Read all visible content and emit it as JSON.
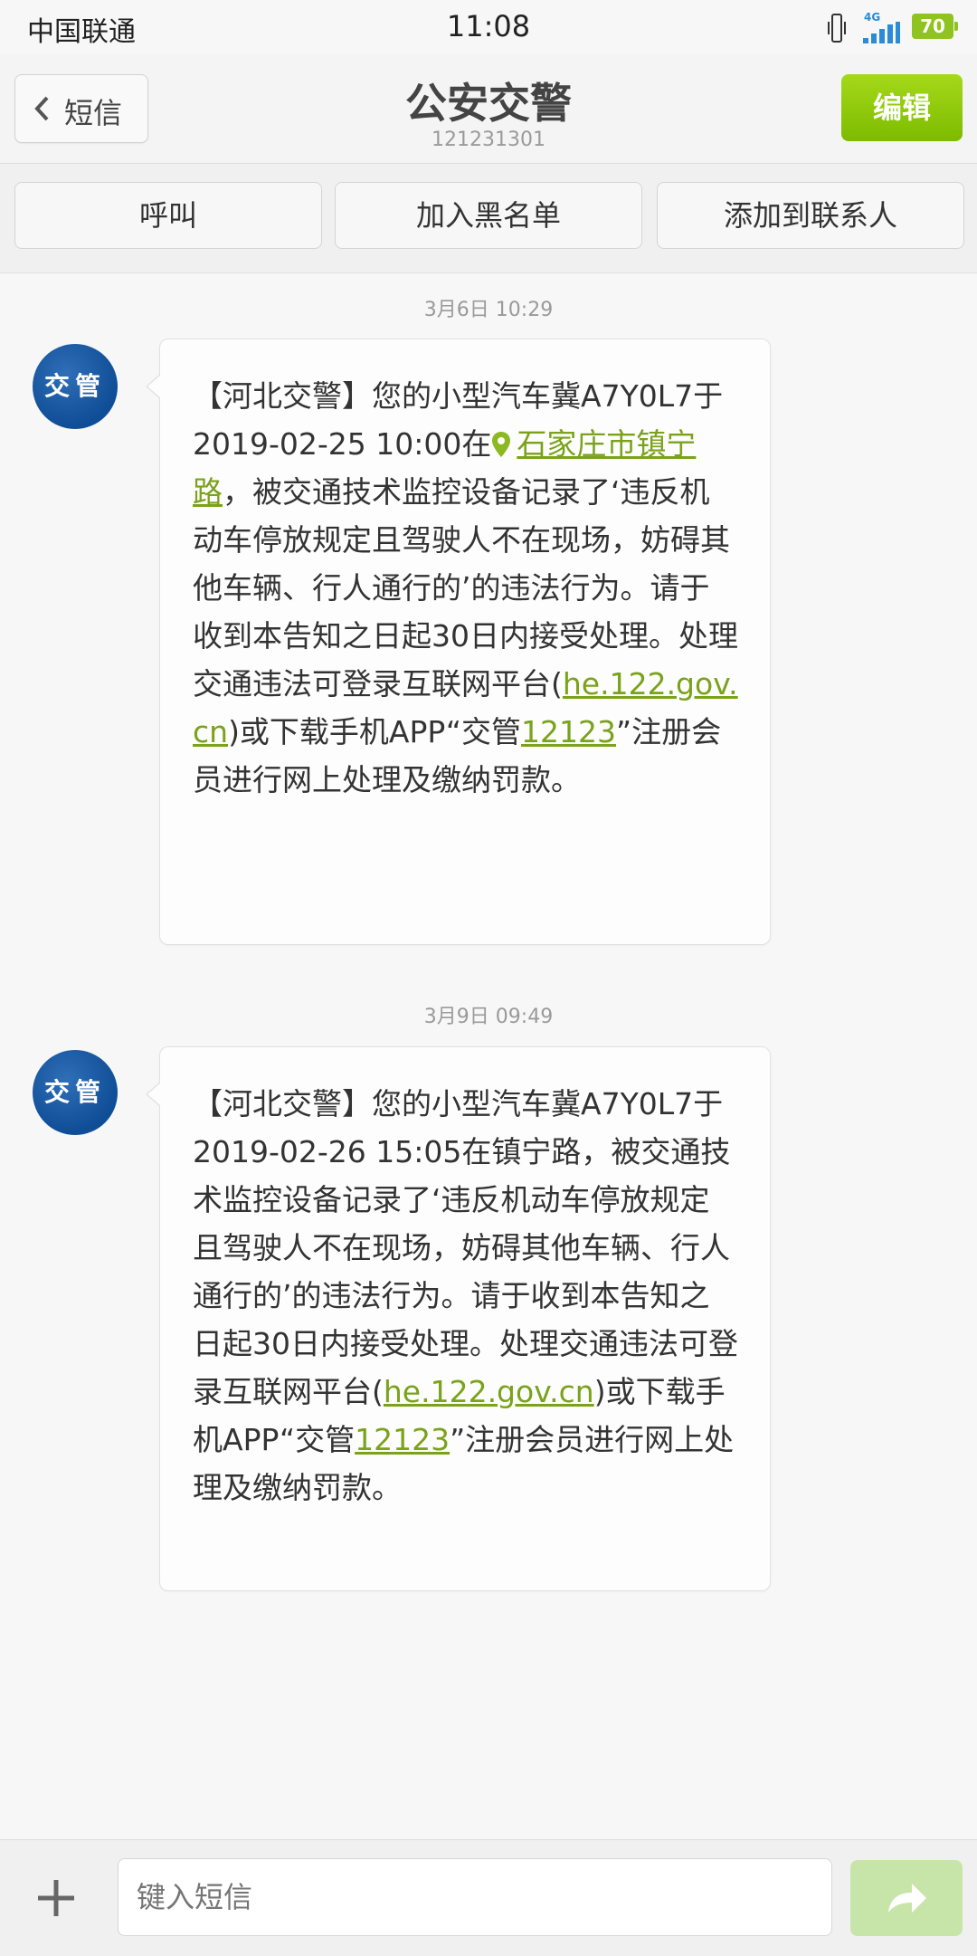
{
  "status_bar": {
    "carrier": "中国联通",
    "time": "11:08",
    "network": "4G",
    "battery": "70"
  },
  "header": {
    "back_label": "短信",
    "title": "公安交警",
    "subtitle": "121231301",
    "edit_label": "编辑"
  },
  "actions": {
    "call": "呼叫",
    "blacklist": "加入黑名单",
    "add_contact": "添加到联系人"
  },
  "messages": [
    {
      "timestamp": "3月6日 10:29",
      "avatar": "交管",
      "parts": [
        "【河北交警】您的小型汽车冀A7Y0L7于2019-02-25 10:00在",
        "石家庄市镇宁路",
        "，被交通技术监控设备记录了‘违反机动车停放规定且驾驶人不在现场，妨碍其他车辆、行人通行的’的违法行为。请于收到本告知之日起30日内接受处理。处理交通违法可登录互联网平台(",
        "he.122.gov.cn",
        ")或下载手机APP“交管",
        "12123",
        "”注册会员进行网上处理及缴纳罚款。"
      ]
    },
    {
      "timestamp": "3月9日 09:49",
      "avatar": "交管",
      "parts": [
        "【河北交警】您的小型汽车冀A7Y0L7于2019-02-26 15:05在镇宁路，被交通技术监控设备记录了‘违反机动车停放规定且驾驶人不在现场，妨碍其他车辆、行人通行的’的违法行为。请于收到本告知之日起30日内接受处理。处理交通违法可登录互联网平台(",
        "he.122.gov.cn",
        ")或下载手机APP“交管",
        "12123",
        "”注册会员进行网上处理及缴纳罚款。"
      ]
    }
  ],
  "composer": {
    "placeholder": "键入短信"
  },
  "colors": {
    "accent_green": "#8fc31f",
    "link_green": "#7aa21a",
    "avatar_blue": "#1a5aa3"
  },
  "icons": [
    "vibrate-icon",
    "signal-icon",
    "battery-icon",
    "chevron-left-icon",
    "location-pin-icon",
    "plus-icon",
    "send-arrow-icon"
  ]
}
